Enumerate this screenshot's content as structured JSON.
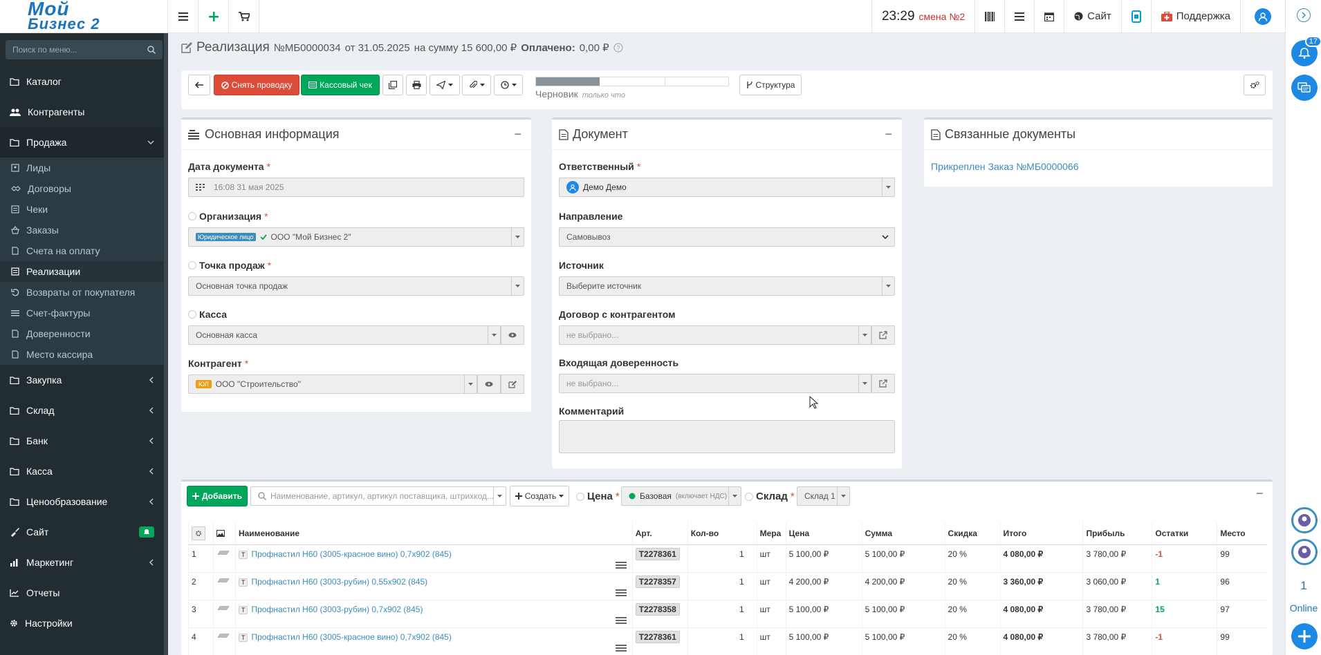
{
  "header": {
    "logo_line1": "Мой",
    "logo_line2": "Бизнес 2",
    "clock": "23:29",
    "shift": "смена №2",
    "site_label": "Сайт",
    "support_label": "Поддержка"
  },
  "rail": {
    "notifications_count": "17",
    "online_count": "1",
    "online_label": "Online"
  },
  "sidebar": {
    "search_placeholder": "Поиск по меню...",
    "items": [
      {
        "label": "Каталог",
        "icon": "folder-icon"
      },
      {
        "label": "Контрагенты",
        "icon": "users-icon"
      },
      {
        "label": "Продажа",
        "icon": "folder-icon"
      },
      {
        "label": "Закупка",
        "icon": "folder-icon"
      },
      {
        "label": "Склад",
        "icon": "folder-icon"
      },
      {
        "label": "Банк",
        "icon": "folder-icon"
      },
      {
        "label": "Касса",
        "icon": "folder-icon"
      },
      {
        "label": "Ценообразование",
        "icon": "folder-icon"
      },
      {
        "label": "Сайт",
        "icon": "paint-icon"
      },
      {
        "label": "Маркетинг",
        "icon": "chart-icon"
      },
      {
        "label": "Отчеты",
        "icon": "line-chart-icon"
      },
      {
        "label": "Настройки",
        "icon": "gear-icon"
      }
    ],
    "sub_items": [
      "Лиды",
      "Договоры",
      "Чеки",
      "Заказы",
      "Счета на оплату",
      "Реализации",
      "Возвраты от покупателя",
      "Счет-фактуры",
      "Доверенности",
      "Место кассира"
    ]
  },
  "page": {
    "title": "Реализация",
    "number": "№МБ0000034",
    "date_part": "от 31.05.2025",
    "sum_part": "на сумму 15 600,00 ₽",
    "paid_label": "Оплачено:",
    "paid_value": "0,00 ₽"
  },
  "toolbar": {
    "unpost_label": "Снять проводку",
    "receipt_label": "Кассовый чек",
    "status_label": "Черновик",
    "status_note": "только что",
    "status_progress": 0.33,
    "structure_label": "Структура"
  },
  "main_info": {
    "title": "Основная информация",
    "date_label": "Дата документа",
    "date_value": "16:08 31 мая 2025",
    "org_label": "Организация",
    "org_tag": "Юридическое лицо",
    "org_value": "ООО \"Мой Бизнес 2\"",
    "point_label": "Точка продаж",
    "point_value": "Основная точка продаж",
    "cash_label": "Касса",
    "cash_value": "Основная касса",
    "contractor_label": "Контрагент",
    "contractor_tag": "ЮЛ",
    "contractor_value": "ООО \"Строительство\""
  },
  "document": {
    "title": "Документ",
    "responsible_label": "Ответственный",
    "responsible_value": "Демо Демо",
    "direction_label": "Направление",
    "direction_value": "Самовывоз",
    "source_label": "Источник",
    "source_value": "Выберите источник",
    "contract_label": "Договор с контрагентом",
    "contract_value": "не выбрано...",
    "proxy_label": "Входящая доверенность",
    "proxy_value": "не выбрано...",
    "comment_label": "Комментарий"
  },
  "related": {
    "title": "Связанные документы",
    "link": "Прикреплен Заказ №МБ0000066"
  },
  "goods": {
    "add_label": "Добавить",
    "search_placeholder": "Наименование, артикул, артикул поставщика, штрихкод...",
    "create_label": "Создать",
    "price_label": "Цена",
    "price_value": "Базовая",
    "price_note": "(включает НДС)",
    "warehouse_label": "Склад",
    "warehouse_value": "Склад 1",
    "columns": [
      "Наименование",
      "Арт.",
      "Кол-во",
      "Мера",
      "Цена",
      "Сумма",
      "Скидка",
      "Итого",
      "Прибыль",
      "Остатки",
      "Место"
    ],
    "rows": [
      {
        "n": "1",
        "name": "Профнастил Н60 (3005-красное вино) 0,7x902 (845)",
        "art": "T2278361",
        "qty": "1",
        "unit": "шт",
        "price": "5 100,00 ₽",
        "sum": "5 100,00 ₽",
        "disc": "20 %",
        "total": "4 080,00 ₽",
        "profit": "3 780,00 ₽",
        "stock": "-1",
        "place": "99"
      },
      {
        "n": "2",
        "name": "Профнастил Н60 (3003-рубин) 0,55x902 (845)",
        "art": "T2278357",
        "qty": "1",
        "unit": "шт",
        "price": "4 200,00 ₽",
        "sum": "4 200,00 ₽",
        "disc": "20 %",
        "total": "3 360,00 ₽",
        "profit": "3 060,00 ₽",
        "stock": "1",
        "place": "96"
      },
      {
        "n": "3",
        "name": "Профнастил Н60 (3003-рубин) 0,7x902 (845)",
        "art": "T2278358",
        "qty": "1",
        "unit": "шт",
        "price": "5 100,00 ₽",
        "sum": "5 100,00 ₽",
        "disc": "20 %",
        "total": "4 080,00 ₽",
        "profit": "3 780,00 ₽",
        "stock": "15",
        "place": "97"
      },
      {
        "n": "4",
        "name": "Профнастил Н60 (3005-красное вино) 0,7x902 (845)",
        "art": "T2278361",
        "qty": "1",
        "unit": "шт",
        "price": "5 100,00 ₽",
        "sum": "5 100,00 ₽",
        "disc": "20 %",
        "total": "4 080,00 ₽",
        "profit": "3 780,00 ₽",
        "stock": "-1",
        "place": "99"
      }
    ]
  }
}
